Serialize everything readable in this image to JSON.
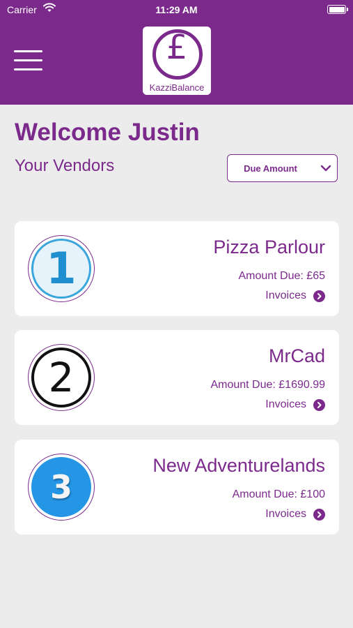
{
  "status_bar": {
    "carrier": "Carrier",
    "time": "11:29 AM"
  },
  "header": {
    "logo_symbol": "£",
    "logo_text": "KazziBalance",
    "menu_icon": "hamburger-menu-icon"
  },
  "welcome": "Welcome Justin",
  "subtitle": "Your Vendors",
  "sort": {
    "selected": "Due Amount"
  },
  "vendors": [
    {
      "rank": "1",
      "name": "Pizza Parlour",
      "amount_due": "Amount Due: £65",
      "invoices_label": "Invoices"
    },
    {
      "rank": "2",
      "name": "MrCad",
      "amount_due": "Amount Due: £1690.99",
      "invoices_label": "Invoices"
    },
    {
      "rank": "3",
      "name": "New Adventurelands",
      "amount_due": "Amount Due: £100",
      "invoices_label": "Invoices"
    }
  ],
  "colors": {
    "brand": "#7b2a8c",
    "background": "#ececec",
    "card": "#ffffff"
  }
}
